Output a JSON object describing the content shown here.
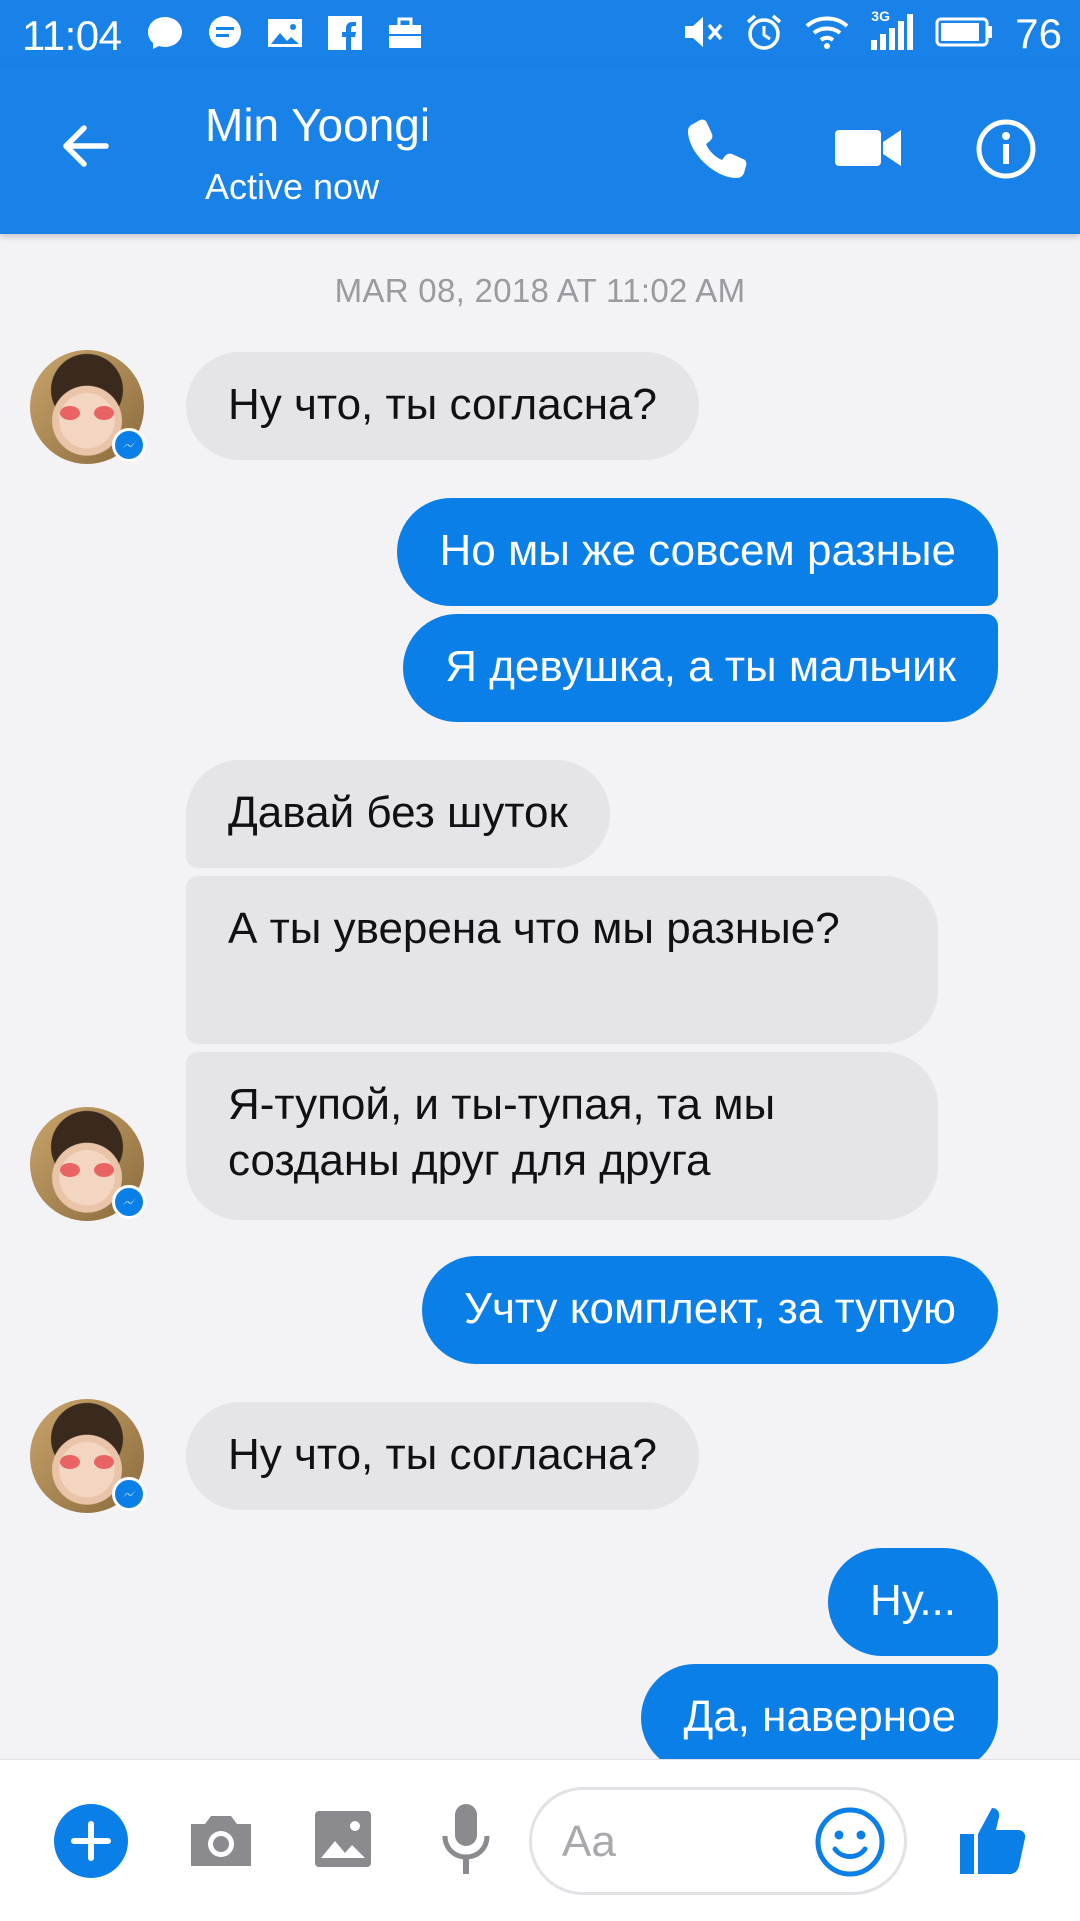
{
  "status_bar": {
    "time": "11:04",
    "network": "3G",
    "battery": "76",
    "left_icons": [
      "messenger-icon",
      "chat-icon",
      "gallery-icon",
      "facebook-icon",
      "briefcase-icon"
    ],
    "right_icons": [
      "mute-icon",
      "alarm-icon",
      "wifi-icon",
      "signal-icon",
      "battery-icon"
    ]
  },
  "header": {
    "contact_name": "Min Yoongi",
    "contact_status": "Active now",
    "icons": [
      "back-arrow-icon",
      "phone-icon",
      "video-camera-icon",
      "info-icon"
    ]
  },
  "conversation": {
    "timestamp": "MAR 08, 2018 AT 11:02 AM",
    "messages": [
      {
        "from": "Min Yoongi",
        "text": "Ну что, ты согласна?"
      },
      {
        "from": "me",
        "text": "Но мы же совсем разные"
      },
      {
        "from": "me",
        "text": "Я девушка, а ты мальчик"
      },
      {
        "from": "Min Yoongi",
        "text": "Давай без шуток"
      },
      {
        "from": "Min Yoongi",
        "text": "А ты уверена что мы разные?"
      },
      {
        "from": "Min Yoongi",
        "text": "Я-тупой, и ты-тупая, та мы созданы друг для друга"
      },
      {
        "from": "me",
        "text": "Учту комплект, за тупую"
      },
      {
        "from": "Min Yoongi",
        "text": "Ну что, ты согласна?"
      },
      {
        "from": "me",
        "text": "Ну..."
      },
      {
        "from": "me",
        "text": "Да, наверное"
      }
    ]
  },
  "composer": {
    "placeholder": "Aa",
    "icons": [
      "plus-icon",
      "camera-icon",
      "image-icon",
      "microphone-icon",
      "emoji-icon",
      "thumbs-up-icon"
    ]
  },
  "colors": {
    "brand_blue": "#1982e8",
    "outgoing_bubble": "#0a7fe8",
    "incoming_bubble": "#e4e4e9",
    "chat_background": "#f3f3f6"
  }
}
